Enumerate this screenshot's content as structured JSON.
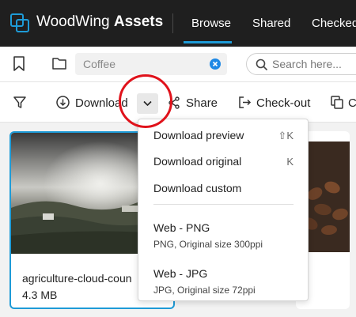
{
  "header": {
    "brand_name": "WoodWing",
    "brand_product": "Assets",
    "nav": [
      "Browse",
      "Shared",
      "Checked"
    ]
  },
  "toolbar": {
    "path_value": "Coffee",
    "search_placeholder": "Search here...",
    "download_label": "Download",
    "share_label": "Share",
    "checkout_label": "Check-out",
    "copy_label": "C"
  },
  "assets": [
    {
      "name": "agriculture-cloud-coun",
      "size": "4.3 MB"
    }
  ],
  "download_menu": {
    "items": [
      {
        "label": "Download preview",
        "shortcut": "⇧K"
      },
      {
        "label": "Download original",
        "shortcut": "K"
      },
      {
        "label": "Download custom",
        "shortcut": ""
      }
    ],
    "presets": [
      {
        "label": "Web - PNG",
        "detail": "PNG, Original size 300ppi"
      },
      {
        "label": "Web - JPG",
        "detail": "JPG, Original size 72ppi"
      }
    ]
  },
  "colors": {
    "accent": "#1e9bd7",
    "highlight": "#e0121b",
    "topbar": "#1f1f1f"
  }
}
